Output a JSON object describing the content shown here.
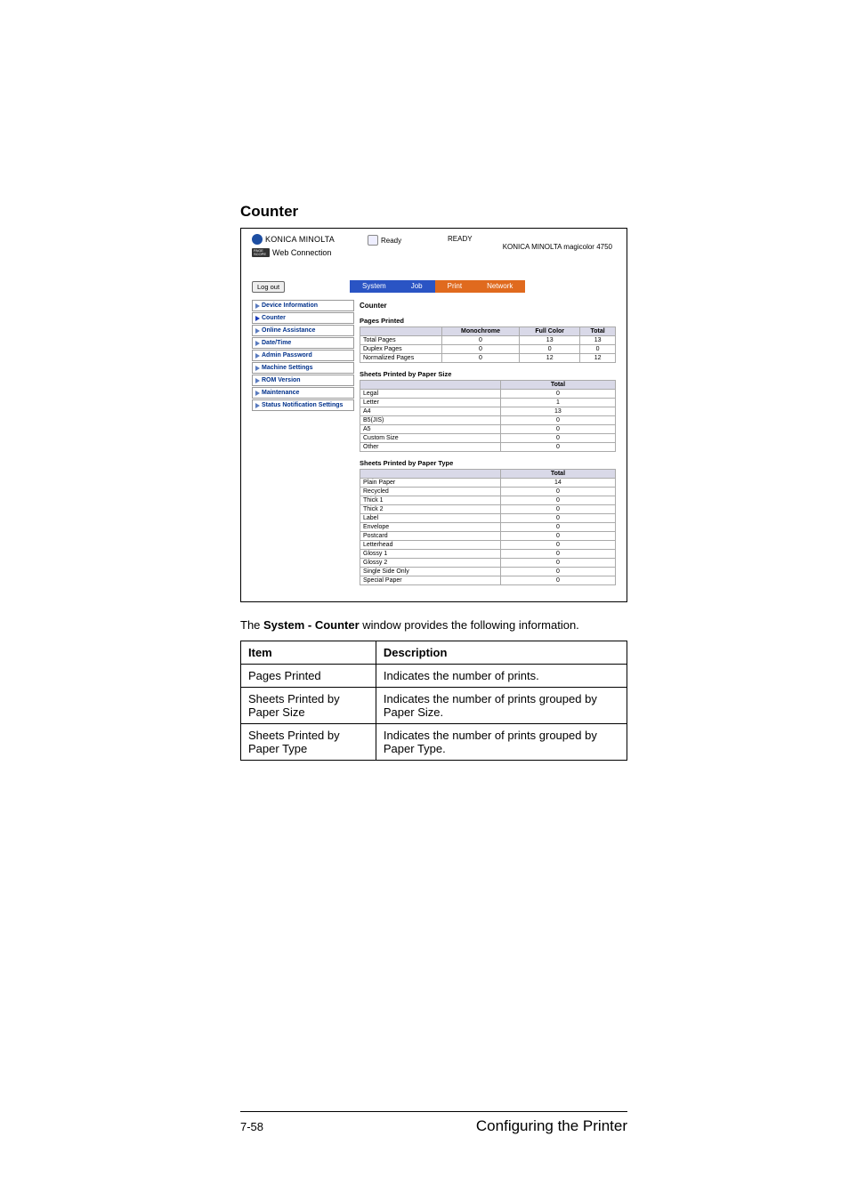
{
  "page": {
    "section_title": "Counter",
    "page_number": "7-58",
    "footer_title": "Configuring the Printer"
  },
  "screenshot": {
    "brand": "KONICA MINOLTA",
    "web_connection": "Web Connection",
    "status_label": "Ready",
    "ready": "READY",
    "model": "KONICA MINOLTA magicolor 4750",
    "logout": "Log out",
    "tabs": {
      "system": "System",
      "job": "Job",
      "print": "Print",
      "network": "Network"
    },
    "sidebar": [
      "Device Information",
      "Counter",
      "Online Assistance",
      "Date/Time",
      "Admin Password",
      "Machine Settings",
      "ROM Version",
      "Maintenance",
      "Status Notification Settings"
    ],
    "content_title": "Counter",
    "sect1": {
      "heading": "Pages Printed",
      "cols": [
        "",
        "Monochrome",
        "Full Color",
        "Total"
      ],
      "rows": [
        {
          "label": "Total Pages",
          "mono": "0",
          "color": "13",
          "total": "13"
        },
        {
          "label": "Duplex Pages",
          "mono": "0",
          "color": "0",
          "total": "0"
        },
        {
          "label": "Normalized Pages",
          "mono": "0",
          "color": "12",
          "total": "12"
        }
      ]
    },
    "sect2": {
      "heading": "Sheets Printed by Paper Size",
      "cols": [
        "",
        "Total"
      ],
      "rows": [
        {
          "label": "Legal",
          "total": "0"
        },
        {
          "label": "Letter",
          "total": "1"
        },
        {
          "label": "A4",
          "total": "13"
        },
        {
          "label": "B5(JIS)",
          "total": "0"
        },
        {
          "label": "A5",
          "total": "0"
        },
        {
          "label": "Custom Size",
          "total": "0"
        },
        {
          "label": "Other",
          "total": "0"
        }
      ]
    },
    "sect3": {
      "heading": "Sheets Printed by Paper Type",
      "cols": [
        "",
        "Total"
      ],
      "rows": [
        {
          "label": "Plain Paper",
          "total": "14"
        },
        {
          "label": "Recycled",
          "total": "0"
        },
        {
          "label": "Thick 1",
          "total": "0"
        },
        {
          "label": "Thick 2",
          "total": "0"
        },
        {
          "label": "Label",
          "total": "0"
        },
        {
          "label": "Envelope",
          "total": "0"
        },
        {
          "label": "Postcard",
          "total": "0"
        },
        {
          "label": "Letterhead",
          "total": "0"
        },
        {
          "label": "Glossy 1",
          "total": "0"
        },
        {
          "label": "Glossy 2",
          "total": "0"
        },
        {
          "label": "Single Side Only",
          "total": "0"
        },
        {
          "label": "Special Paper",
          "total": "0"
        }
      ]
    }
  },
  "caption": {
    "prefix": "The ",
    "bold": "System - Counter",
    "suffix": " window provides the following information."
  },
  "info_table": {
    "header": {
      "item": "Item",
      "desc": "Description"
    },
    "rows": [
      {
        "item": "Pages Printed",
        "desc": "Indicates the number of prints."
      },
      {
        "item": "Sheets Printed by Paper Size",
        "desc": "Indicates the number of prints grouped by Paper Size."
      },
      {
        "item": "Sheets Printed by Paper Type",
        "desc": "Indicates the number of prints grouped by Paper Type."
      }
    ]
  }
}
